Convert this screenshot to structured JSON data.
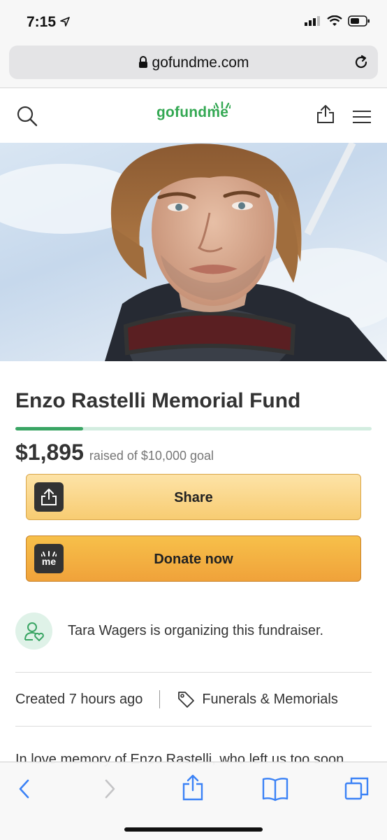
{
  "status": {
    "time": "7:15"
  },
  "browser": {
    "url": "gofundme.com"
  },
  "site": {
    "logo": "gofundme"
  },
  "campaign": {
    "title": "Enzo Rastelli Memorial Fund",
    "raised": "$1,895",
    "goal_text": "raised of $10,000 goal",
    "progress_fraction": 0.19,
    "share_label": "Share",
    "donate_label": "Donate now",
    "donate_icon_text": "me",
    "organizer_text": "Tara Wagers is organizing this fundraiser.",
    "created": "Created 7 hours ago",
    "category": "Funerals & Memorials",
    "story_start": "In love memory of Enzo Rastelli, who left us too soon"
  },
  "colors": {
    "brand_green": "#34a853",
    "progress_fill": "#3aa564",
    "share_button": "#f8cc72",
    "donate_button": "#f0a23a",
    "safari_blue": "#3b82f6"
  },
  "icons": {
    "status": [
      "location-arrow-icon",
      "signal-icon",
      "wifi-icon",
      "battery-icon"
    ],
    "header": [
      "search-icon",
      "share-icon",
      "menu-icon"
    ],
    "toolbar": [
      "back-icon",
      "forward-icon",
      "share-icon",
      "bookmarks-icon",
      "tabs-icon"
    ]
  }
}
